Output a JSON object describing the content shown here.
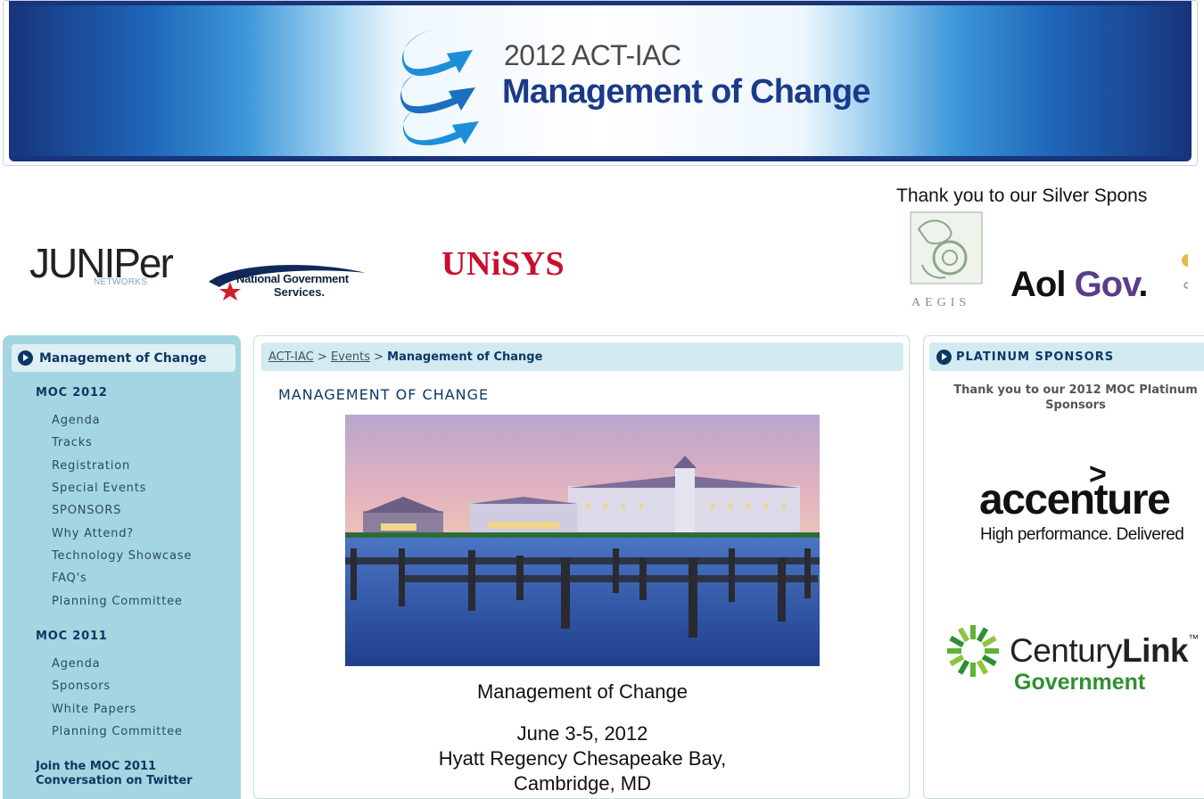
{
  "banner": {
    "year_line": "2012 ACT-IAC",
    "title": "Management of Change"
  },
  "sponsors_strip": {
    "silver_title": "Thank you to our Silver Spons",
    "logos": [
      {
        "name": "juniper",
        "text": "JUNIPer",
        "sub": "NETWORKS"
      },
      {
        "name": "national-government-services",
        "text": "National Government",
        "text2": "Services."
      },
      {
        "name": "unisys",
        "text": "UNiSYS"
      },
      {
        "name": "aegis",
        "text": "AEGIS"
      },
      {
        "name": "aol-gov",
        "text": "Aol",
        "text2": "Gov",
        "dot": "."
      }
    ]
  },
  "sidebar": {
    "header": "Management of Change",
    "sections": [
      {
        "title": "MOC 2012",
        "items": [
          "Agenda",
          "Tracks",
          "Registration",
          "Special Events",
          "SPONSORS",
          "Why Attend?",
          "Technology Showcase",
          "FAQ's",
          "Planning Committee"
        ]
      },
      {
        "title": "MOC 2011",
        "items": [
          "Agenda",
          "Sponsors",
          "White Papers",
          "Planning Committee"
        ]
      }
    ],
    "twitter_link": {
      "line1": "Join the MOC 2011",
      "line2": "Conversation on Twitter"
    }
  },
  "main": {
    "breadcrumb": [
      "ACT-IAC",
      "Events",
      "Management of Change"
    ],
    "breadcrumb_sep": ">",
    "heading": "MANAGEMENT OF CHANGE",
    "caption_title": "Management of Change",
    "date": "June 3-5, 2012",
    "venue": "Hyatt Regency Chesapeake Bay,",
    "city": "Cambridge, MD"
  },
  "right_sidebar": {
    "header": "PLATINUM SPONSORS",
    "thanks": "Thank you to our 2012 MOC Platinum Sponsors",
    "accenture": {
      "mark": ">",
      "word": "accenture",
      "tagline": "High performance. Delivered"
    },
    "centurylink": {
      "word_a": "Century",
      "word_b": "Link",
      "tm": "™",
      "sub": "Government"
    }
  },
  "colors": {
    "brand_navy": "#0c3866",
    "sidebar_bg": "#a3d6e0",
    "header_bar": "#d2eaf0",
    "unisys_red": "#c8102e",
    "aol_purple": "#5a3d8a",
    "centurylink_green": "#2f8f2f"
  }
}
